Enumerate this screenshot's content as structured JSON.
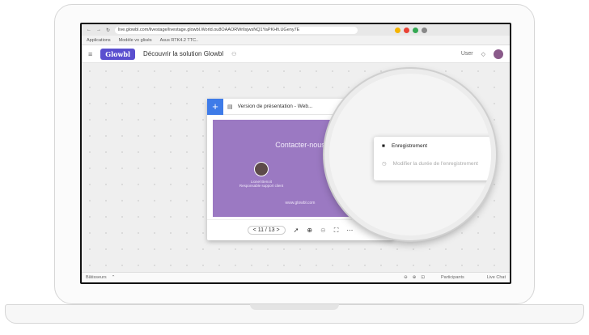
{
  "browser": {
    "url": "live.glowbl.com/livestage/livestage.glowbl.World.ou8OAAORWrllsjwsNQ1YaPKHfi.UGeny7E",
    "bookmarks": [
      "Applications",
      "Modèle vo glisés",
      "Asus RTK4.2 TTC.."
    ]
  },
  "app": {
    "logo": "Glowbl",
    "title": "Découvrir la solution Glowbl",
    "share_user": "User"
  },
  "document": {
    "title": "Version de présentation - Web...",
    "slide_heading": "Contacter-nous",
    "website": "www.glowbl.com",
    "person1": "Lionel Benoit",
    "person1_detail": "Responsable support client",
    "page_label": "< 11 / 13 >"
  },
  "context_menu": {
    "item1": "Enregistrement",
    "item2": "Modifier la durée de l'enregistrement"
  },
  "status": {
    "left": "Bâtisseurs",
    "participants": "Participants",
    "live_chat": "Live Chat"
  },
  "colors": {
    "accent": "#3e7be8",
    "slide": "#9b79c2",
    "logo": "#5a4fcf"
  }
}
